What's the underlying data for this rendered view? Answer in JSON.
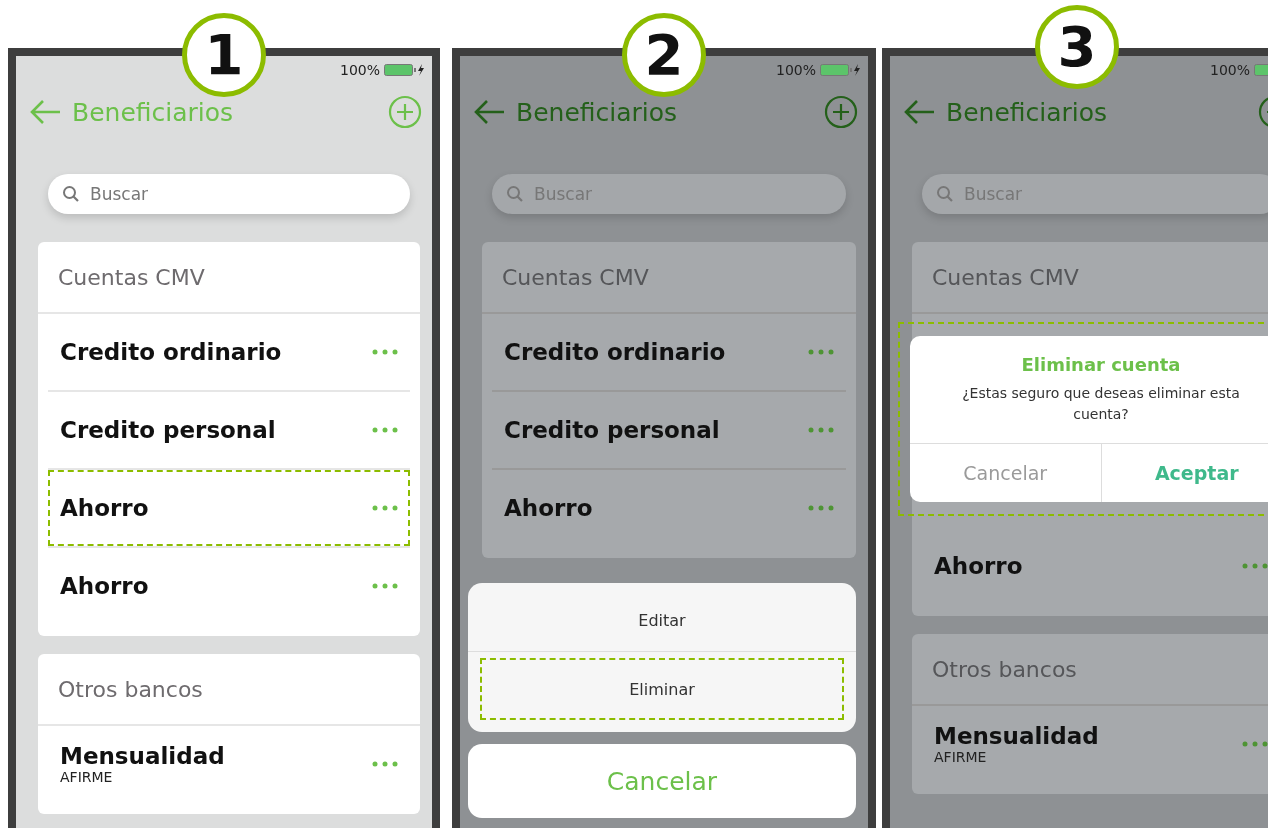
{
  "screens": [
    {
      "step": "1",
      "battery": "100%",
      "title": "Beneficiarios",
      "search_placeholder": "Buscar",
      "dimmed": false,
      "sections": [
        {
          "title": "Cuentas CMV",
          "items": [
            {
              "name": "Credito ordinario",
              "highlighted": false
            },
            {
              "name": "Credito personal",
              "highlighted": false
            },
            {
              "name": "Ahorro",
              "highlighted": true
            },
            {
              "name": "Ahorro",
              "highlighted": false
            }
          ]
        },
        {
          "title": "Otros bancos",
          "items": [
            {
              "name": "Mensualidad",
              "subtitle": "AFIRME",
              "highlighted": false
            }
          ]
        }
      ]
    },
    {
      "step": "2",
      "battery": "100%",
      "title": "Beneficiarios",
      "search_placeholder": "Buscar",
      "dimmed": true,
      "sections": [
        {
          "title": "Cuentas CMV",
          "items": [
            {
              "name": "Credito ordinario",
              "highlighted": false
            },
            {
              "name": "Credito personal",
              "highlighted": false
            },
            {
              "name": "Ahorro",
              "highlighted": false
            }
          ]
        }
      ],
      "action_sheet": {
        "options": [
          {
            "label": "Editar",
            "highlighted": false
          },
          {
            "label": "Eliminar",
            "highlighted": true
          }
        ],
        "cancel": "Cancelar"
      }
    },
    {
      "step": "3",
      "battery": "100%",
      "title": "Beneficiarios",
      "search_placeholder": "Buscar",
      "dimmed": true,
      "sections": [
        {
          "title": "Cuentas CMV",
          "dialog": {
            "title": "Eliminar cuenta",
            "message": "¿Estas seguro que deseas eliminar esta cuenta?",
            "highlighted": true,
            "buttons": [
              {
                "label": "Cancelar",
                "kind": "cancel"
              },
              {
                "label": "Aceptar",
                "kind": "confirm"
              }
            ]
          },
          "items": [
            {
              "name": "Ahorro",
              "highlighted": false
            }
          ]
        },
        {
          "title": "Otros bancos",
          "items": [
            {
              "name": "Mensualidad",
              "subtitle": "AFIRME",
              "highlighted": false
            }
          ]
        }
      ]
    }
  ]
}
